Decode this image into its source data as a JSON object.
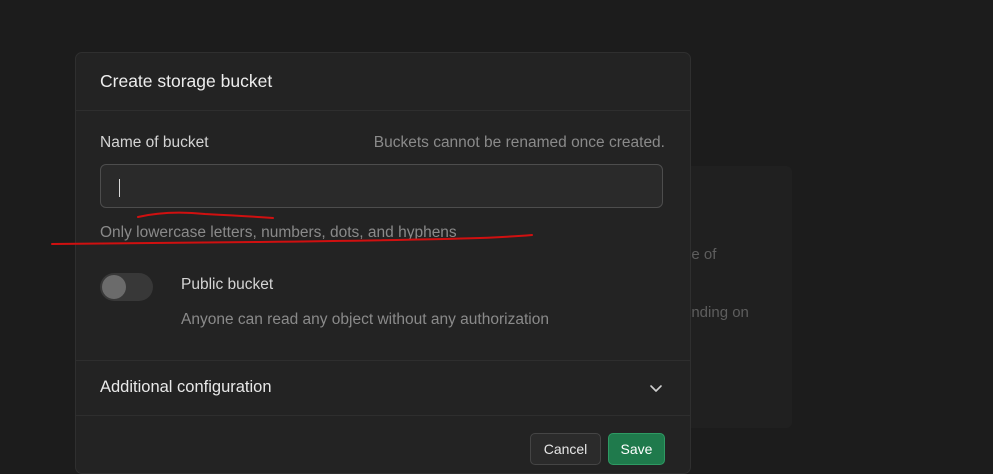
{
  "background": {
    "snippet_1": "ne of",
    "snippet_2": "ending on"
  },
  "modal": {
    "title": "Create storage bucket",
    "name_field": {
      "label": "Name of bucket",
      "hint_right": "Buckets cannot be renamed once created.",
      "value": "",
      "help_text": "Only lowercase letters, numbers, dots, and hyphens"
    },
    "public_toggle": {
      "label": "Public bucket",
      "description": "Anyone can read any object without any authorization",
      "enabled": false
    },
    "accordion": {
      "label": "Additional configuration",
      "expanded": false
    },
    "buttons": {
      "cancel_label": "Cancel",
      "save_label": "Save"
    }
  },
  "annotation": {
    "color": "#d01010",
    "kind": "hand-drawn red underline"
  },
  "colors": {
    "background": "#1c1c1c",
    "modal": "#232323",
    "accent_save": "#1f7a4c"
  }
}
